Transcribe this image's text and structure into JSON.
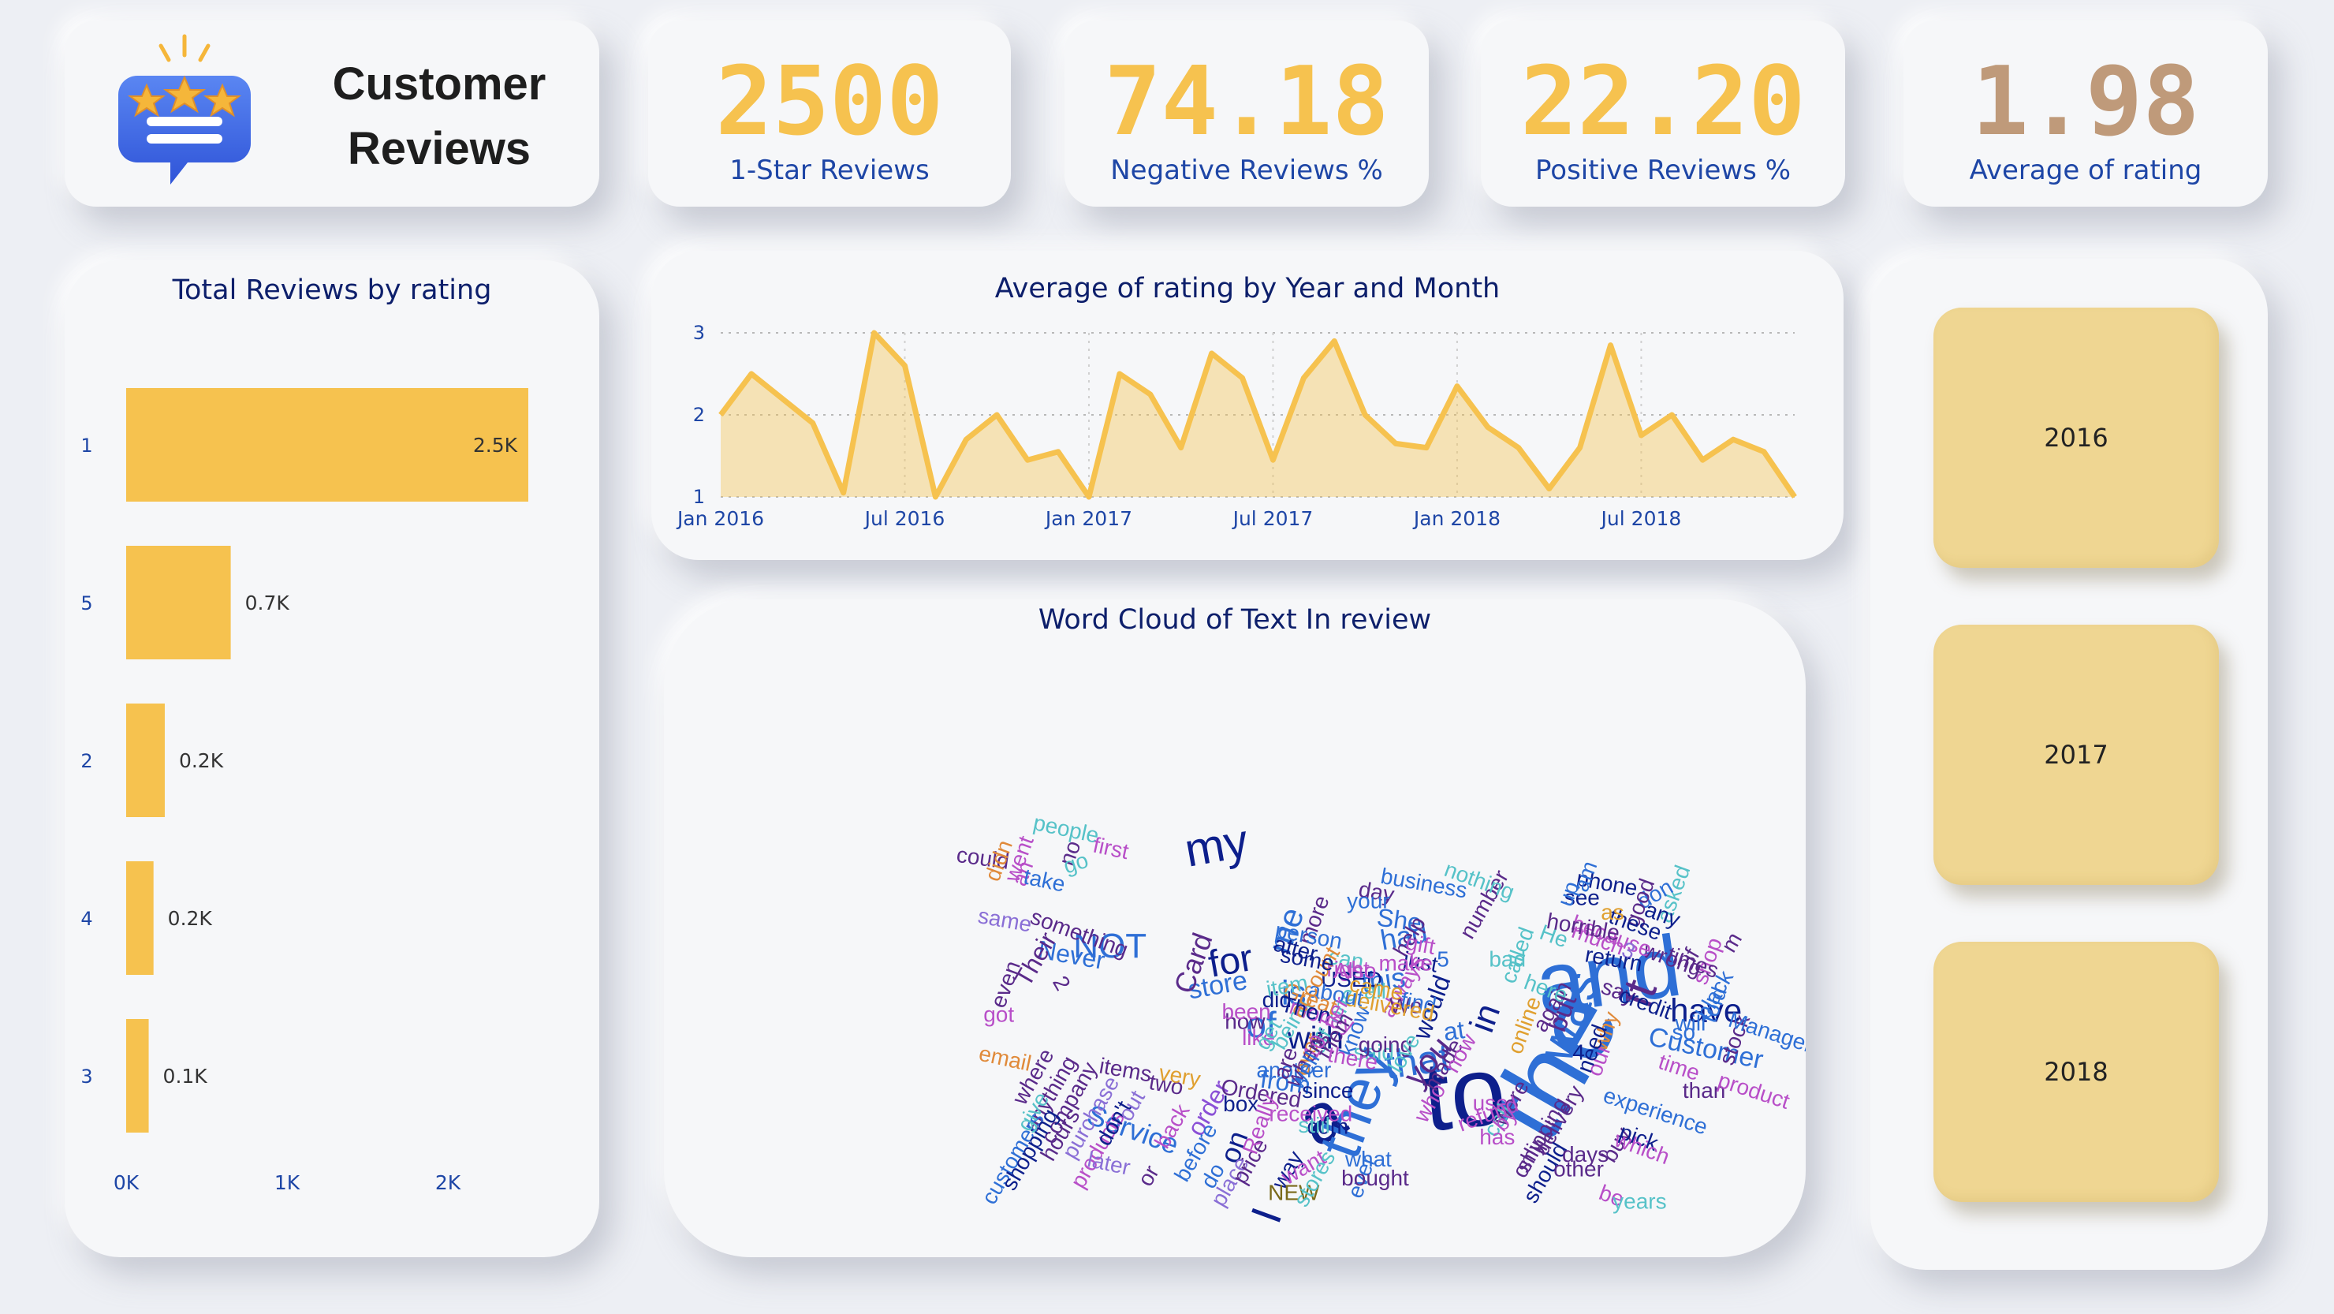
{
  "header": {
    "title_line1": "Customer",
    "title_line2": "Reviews"
  },
  "kpis": [
    {
      "value": "2500",
      "label": "1-Star Reviews",
      "color": "#f6c24f"
    },
    {
      "value": "74.18",
      "label": "Negative Reviews %",
      "color": "#f6c24f"
    },
    {
      "value": "22.20",
      "label": "Positive Reviews %",
      "color": "#f6c24f"
    },
    {
      "value": "1.98",
      "label": "Average of rating",
      "color": "#bf9a7a"
    }
  ],
  "bar_panel": {
    "title": "Total Reviews by rating"
  },
  "line_panel": {
    "title": "Average of rating by Year and Month"
  },
  "wordcloud_panel": {
    "title": "Word Cloud of Text In review"
  },
  "slicer": {
    "years": [
      "2016",
      "2017",
      "2018"
    ]
  },
  "colors": {
    "accent": "#f6c24f",
    "title_blue": "#0d1f6b",
    "label_blue": "#1e46a6"
  },
  "icons": {
    "logo": "chat-bubble-with-stars-icon"
  },
  "chart_data": [
    {
      "type": "bar",
      "orientation": "horizontal",
      "title": "Total Reviews by rating",
      "categories": [
        "1",
        "5",
        "2",
        "4",
        "3"
      ],
      "values": [
        2500,
        650,
        240,
        170,
        140
      ],
      "data_labels": [
        "2.5K",
        "0.7K",
        "0.2K",
        "0.2K",
        "0.1K"
      ],
      "xlim": [
        0,
        2500
      ],
      "x_ticks": [
        "0K",
        "1K",
        "2K"
      ],
      "color": "#f6c24f"
    },
    {
      "type": "area",
      "title": "Average of rating by Year and Month",
      "x": [
        "2016-01",
        "2016-02",
        "2016-03",
        "2016-04",
        "2016-05",
        "2016-06",
        "2016-07",
        "2016-08",
        "2016-09",
        "2016-10",
        "2016-11",
        "2016-12",
        "2017-01",
        "2017-02",
        "2017-03",
        "2017-04",
        "2017-05",
        "2017-06",
        "2017-07",
        "2017-08",
        "2017-09",
        "2017-10",
        "2017-11",
        "2017-12",
        "2018-01",
        "2018-02",
        "2018-03",
        "2018-04",
        "2018-05",
        "2018-06",
        "2018-07",
        "2018-08",
        "2018-09",
        "2018-10",
        "2018-11",
        "2018-12"
      ],
      "values": [
        2.0,
        2.5,
        2.2,
        1.9,
        1.05,
        3.0,
        2.6,
        1.0,
        1.7,
        2.0,
        1.45,
        1.55,
        1.0,
        2.5,
        2.25,
        1.6,
        2.75,
        2.45,
        1.45,
        2.45,
        2.9,
        2.0,
        1.65,
        1.6,
        2.35,
        1.85,
        1.6,
        1.1,
        1.6,
        2.85,
        1.75,
        2.0,
        1.45,
        1.7,
        1.55,
        1.0
      ],
      "x_ticks": [
        "Jan 2016",
        "Jul 2016",
        "Jan 2017",
        "Jul 2017",
        "Jan 2018",
        "Jul 2018"
      ],
      "ylim": [
        1,
        3
      ],
      "y_ticks": [
        "1",
        "2",
        "3"
      ],
      "grid": true,
      "color": "#f6c24f"
    }
  ],
  "wordcloud": {
    "words": [
      {
        "t": "the",
        "c": "#2e6fd6"
      },
      {
        "t": "and",
        "c": "#2e6fd6"
      },
      {
        "t": "to",
        "c": "#0d1f8c"
      },
      {
        "t": "a",
        "c": "#0d1f8c"
      },
      {
        "t": "they",
        "c": "#2e6fd6"
      },
      {
        "t": "my",
        "c": "#0d1f8c"
      },
      {
        "t": "it",
        "c": "#5a2a8a"
      },
      {
        "t": "was",
        "c": "#2e6fd6"
      },
      {
        "t": "I",
        "c": "#0d1f8c"
      },
      {
        "t": "that",
        "c": "#2e6fd6"
      },
      {
        "t": "NOT",
        "c": "#2e6fd6"
      },
      {
        "t": "for",
        "c": "#0d1f8c"
      },
      {
        "t": "is",
        "c": "#2e6fd6"
      },
      {
        "t": "have",
        "c": "#0d1f8c"
      },
      {
        "t": "in",
        "c": "#0d1f8c"
      },
      {
        "t": "of",
        "c": "#2e6fd6"
      },
      {
        "t": "you",
        "c": "#5a2a8a"
      },
      {
        "t": "with",
        "c": "#0d1f8c"
      },
      {
        "t": "me",
        "c": "#2e6fd6"
      },
      {
        "t": "had",
        "c": "#2e6fd6"
      },
      {
        "t": "Customer",
        "c": "#2e6fd6"
      },
      {
        "t": "Service",
        "c": "#2e6fd6"
      },
      {
        "t": "this",
        "c": "#2e6fd6"
      },
      {
        "t": "on",
        "c": "#0d1f8c"
      },
      {
        "t": "store",
        "c": "#2e6fd6"
      },
      {
        "t": "Card",
        "c": "#5a2a8a"
      },
      {
        "t": "would",
        "c": "#0d1f8c"
      },
      {
        "t": "order",
        "c": "#8a4fd6"
      },
      {
        "t": "but",
        "c": "#5a2a8a"
      },
      {
        "t": "at",
        "c": "#2e6fd6"
      },
      {
        "t": "from",
        "c": "#2e6fd6"
      },
      {
        "t": "She",
        "c": "#2e6fd6"
      },
      {
        "t": "Never",
        "c": "#2e6fd6"
      },
      {
        "t": "Their",
        "c": "#5a2a8a"
      },
      {
        "t": "people",
        "c": "#56c2c8"
      },
      {
        "t": "first",
        "c": "#b84fc8"
      },
      {
        "t": "could",
        "c": "#5a2a8a"
      },
      {
        "t": "went",
        "c": "#b84fc8"
      },
      {
        "t": "didn",
        "c": "#e08a3a"
      },
      {
        "t": "no",
        "c": "#5a2a8a"
      },
      {
        "t": "go",
        "c": "#56c2c8"
      },
      {
        "t": "an",
        "c": "#b84fc8"
      },
      {
        "t": "take",
        "c": "#2e6fd6"
      },
      {
        "t": "same",
        "c": "#8a6fd6"
      },
      {
        "t": "something",
        "c": "#5a2a8a"
      },
      {
        "t": "even",
        "c": "#5a2a8a"
      },
      {
        "t": "2",
        "c": "#5a2a8a"
      },
      {
        "t": "got",
        "c": "#b84fc8"
      },
      {
        "t": "email",
        "c": "#e08a3a"
      },
      {
        "t": "where",
        "c": "#5a2a8a"
      },
      {
        "t": "anything",
        "c": "#5a2a8a"
      },
      {
        "t": "company",
        "c": "#5a2a8a"
      },
      {
        "t": "customers",
        "c": "#2e6fd6"
      },
      {
        "t": "shopping",
        "c": "#0d1f8c"
      },
      {
        "t": "give",
        "c": "#56c2c8"
      },
      {
        "t": "hours",
        "c": "#5a2a8a"
      },
      {
        "t": "purchase",
        "c": "#8a6fd6"
      },
      {
        "t": "products",
        "c": "#b84fc8"
      },
      {
        "t": "don't",
        "c": "#0d1f8c"
      },
      {
        "t": "out",
        "c": "#8a6fd6"
      },
      {
        "t": "items",
        "c": "#5a2a8a"
      },
      {
        "t": "two",
        "c": "#5a2a8a"
      },
      {
        "t": "very",
        "c": "#e0a030"
      },
      {
        "t": "back",
        "c": "#b84fc8"
      },
      {
        "t": "before",
        "c": "#2e6fd6"
      },
      {
        "t": "do",
        "c": "#2e6fd6"
      },
      {
        "t": "place",
        "c": "#8a6fd6"
      },
      {
        "t": "later",
        "c": "#8a6fd6"
      },
      {
        "t": "or",
        "c": "#5a2a8a"
      },
      {
        "t": "price",
        "c": "#5a2a8a"
      },
      {
        "t": "way",
        "c": "#0d1f8c"
      },
      {
        "t": "NEW",
        "c": "#7a6a1a"
      },
      {
        "t": "want",
        "c": "#b84fc8"
      },
      {
        "t": "stores",
        "c": "#56c2c8"
      },
      {
        "t": "ever",
        "c": "#2e6fd6"
      },
      {
        "t": "what",
        "c": "#2e6fd6"
      },
      {
        "t": "bought",
        "c": "#5a2a8a"
      },
      {
        "t": "com",
        "c": "#0d1f8c"
      },
      {
        "t": "still",
        "c": "#56c2c8"
      },
      {
        "t": "received",
        "c": "#b84fc8"
      },
      {
        "t": "box",
        "c": "#0d1f8c"
      },
      {
        "t": "Ordered",
        "c": "#5a2a8a"
      },
      {
        "t": "Really",
        "c": "#b84fc8"
      },
      {
        "t": "since",
        "c": "#0d1f8c"
      },
      {
        "t": "another",
        "c": "#2e6fd6"
      },
      {
        "t": "are",
        "c": "#5a2a8a"
      },
      {
        "t": "like",
        "c": "#b84fc8"
      },
      {
        "t": "how",
        "c": "#5a2a8a"
      },
      {
        "t": "been",
        "c": "#b84fc8"
      },
      {
        "t": "get",
        "c": "#56c2c8"
      },
      {
        "t": "being",
        "c": "#56c2c8"
      },
      {
        "t": "over",
        "c": "#e08a3a"
      },
      {
        "t": "off",
        "c": "#56c2c8"
      },
      {
        "t": "money",
        "c": "#b84fc8"
      },
      {
        "t": "one",
        "c": "#56c2c8"
      },
      {
        "t": "them",
        "c": "#5a2a8a"
      },
      {
        "t": "know",
        "c": "#2e6fd6"
      },
      {
        "t": "said",
        "c": "#56c2c8"
      },
      {
        "t": "going",
        "c": "#5a2a8a"
      },
      {
        "t": "love",
        "c": "#56c2c8"
      },
      {
        "t": "who",
        "c": "#b84fc8"
      },
      {
        "t": "made",
        "c": "#5a2a8a"
      },
      {
        "t": "now",
        "c": "#b84fc8"
      },
      {
        "t": "use",
        "c": "#b84fc8"
      },
      {
        "t": "call",
        "c": "#56c2c8"
      },
      {
        "t": "were",
        "c": "#5a2a8a"
      },
      {
        "t": "only",
        "c": "#5a2a8a"
      },
      {
        "t": "shipping",
        "c": "#5a2a8a"
      },
      {
        "t": "delivery",
        "c": "#5a2a8a"
      },
      {
        "t": "should",
        "c": "#0d1f8c"
      },
      {
        "t": "other",
        "c": "#5a2a8a"
      },
      {
        "t": "days",
        "c": "#5a2a8a"
      },
      {
        "t": "be",
        "c": "#b84fc8"
      },
      {
        "t": "years",
        "c": "#56c2c8"
      },
      {
        "t": "buy",
        "c": "#5a2a8a"
      },
      {
        "t": "pick",
        "c": "#0d1f8c"
      },
      {
        "t": "which",
        "c": "#b84fc8"
      },
      {
        "t": "experience",
        "c": "#2e6fd6"
      },
      {
        "t": "time",
        "c": "#b84fc8"
      },
      {
        "t": "than",
        "c": "#5a2a8a"
      },
      {
        "t": "product",
        "c": "#b84fc8"
      },
      {
        "t": "so",
        "c": "#2e6fd6"
      },
      {
        "t": "will",
        "c": "#2e6fd6"
      },
      {
        "t": "told",
        "c": "#2e6fd6"
      },
      {
        "t": "stock",
        "c": "#5a2a8a"
      },
      {
        "t": "Manager",
        "c": "#2e6fd6"
      },
      {
        "t": "black",
        "c": "#2e6fd6"
      },
      {
        "t": "m",
        "c": "#5a2a8a"
      },
      {
        "t": "shop",
        "c": "#b84fc8"
      },
      {
        "t": "if",
        "c": "#5a2a8a"
      },
      {
        "t": "times",
        "c": "#5a2a8a"
      },
      {
        "t": "wrong",
        "c": "#5a2a8a"
      },
      {
        "t": "asked",
        "c": "#56c2c8"
      },
      {
        "t": "don",
        "c": "#2e6fd6"
      },
      {
        "t": "good",
        "c": "#5a2a8a"
      },
      {
        "t": "any",
        "c": "#0d1f8c"
      },
      {
        "t": "these",
        "c": "#0d1f8c"
      },
      {
        "t": "as",
        "c": "#e0a030"
      },
      {
        "t": "because",
        "c": "#b84fc8"
      },
      {
        "t": "much",
        "c": "#b84fc8"
      },
      {
        "t": "3",
        "c": "#8a6fd6"
      },
      {
        "t": "return",
        "c": "#0d1f8c"
      },
      {
        "t": "say",
        "c": "#5a2a8a"
      },
      {
        "t": "credit",
        "c": "#0d1f8c"
      },
      {
        "t": "why",
        "c": "#e08a3a"
      },
      {
        "t": "our",
        "c": "#b84fc8"
      },
      {
        "t": "need",
        "c": "#0d1f8c"
      },
      {
        "t": "again",
        "c": "#5a2a8a"
      },
      {
        "t": "online",
        "c": "#e0a030"
      },
      {
        "t": "here",
        "c": "#56c2c8"
      },
      {
        "t": "He",
        "c": "#56c2c8"
      },
      {
        "t": "called",
        "c": "#56c2c8"
      },
      {
        "t": "bad",
        "c": "#56c2c8"
      },
      {
        "t": "horrible",
        "c": "#5a2a8a"
      },
      {
        "t": "phone",
        "c": "#0d1f8c"
      },
      {
        "t": "see",
        "c": "#0d1f8c"
      },
      {
        "t": "am",
        "c": "#2e6fd6"
      },
      {
        "t": "up",
        "c": "#2e6fd6"
      },
      {
        "t": "number",
        "c": "#5a2a8a"
      },
      {
        "t": "nothing",
        "c": "#56c2c8"
      },
      {
        "t": "business",
        "c": "#2e6fd6"
      },
      {
        "t": "day",
        "c": "#5a2a8a"
      },
      {
        "t": "your",
        "c": "#2e6fd6"
      },
      {
        "t": "more",
        "c": "#5a2a8a"
      },
      {
        "t": "help",
        "c": "#5a2a8a"
      },
      {
        "t": "gift",
        "c": "#b84fc8"
      },
      {
        "t": "5",
        "c": "#2e6fd6"
      },
      {
        "t": "just",
        "c": "#0d1f8c"
      },
      {
        "t": "always",
        "c": "#b84fc8"
      },
      {
        "t": "We",
        "c": "#5a2a8a"
      },
      {
        "t": "find",
        "c": "#2e6fd6"
      },
      {
        "t": "make",
        "c": "#b84fc8"
      },
      {
        "t": "can",
        "c": "#56c2c8"
      },
      {
        "t": "right",
        "c": "#b84fc8"
      },
      {
        "t": "USED",
        "c": "#0d1f8c"
      },
      {
        "t": "all",
        "c": "#56c2c8"
      },
      {
        "t": "came",
        "c": "#e0a030"
      },
      {
        "t": "delivered",
        "c": "#e0a030"
      },
      {
        "t": "Also",
        "c": "#b84fc8"
      },
      {
        "t": "about",
        "c": "#2e6fd6"
      },
      {
        "t": "Great",
        "c": "#e08a3a"
      },
      {
        "t": "item",
        "c": "#56c2c8"
      },
      {
        "t": "did",
        "c": "#0d1f8c"
      },
      {
        "t": "after",
        "c": "#0d1f8c"
      },
      {
        "t": "person",
        "c": "#2e6fd6"
      },
      {
        "t": "account",
        "c": "#e08a3a"
      },
      {
        "t": "some",
        "c": "#0d1f8c"
      },
      {
        "t": "Then",
        "c": "#0d1f8c"
      },
      {
        "t": "her",
        "c": "#b84fc8"
      },
      {
        "t": "s",
        "c": "#5a2a8a"
      },
      {
        "t": "10",
        "c": "#b84fc8"
      },
      {
        "t": "when",
        "c": "#5a2a8a"
      },
      {
        "t": "well",
        "c": "#2e6fd6"
      },
      {
        "t": "there",
        "c": "#b84fc8"
      },
      {
        "t": "refund",
        "c": "#b84fc8"
      },
      {
        "t": "has",
        "c": "#b84fc8"
      },
      {
        "t": "by",
        "c": "#b84fc8"
      },
      {
        "t": "4",
        "c": "#0d1f8c"
      }
    ]
  }
}
